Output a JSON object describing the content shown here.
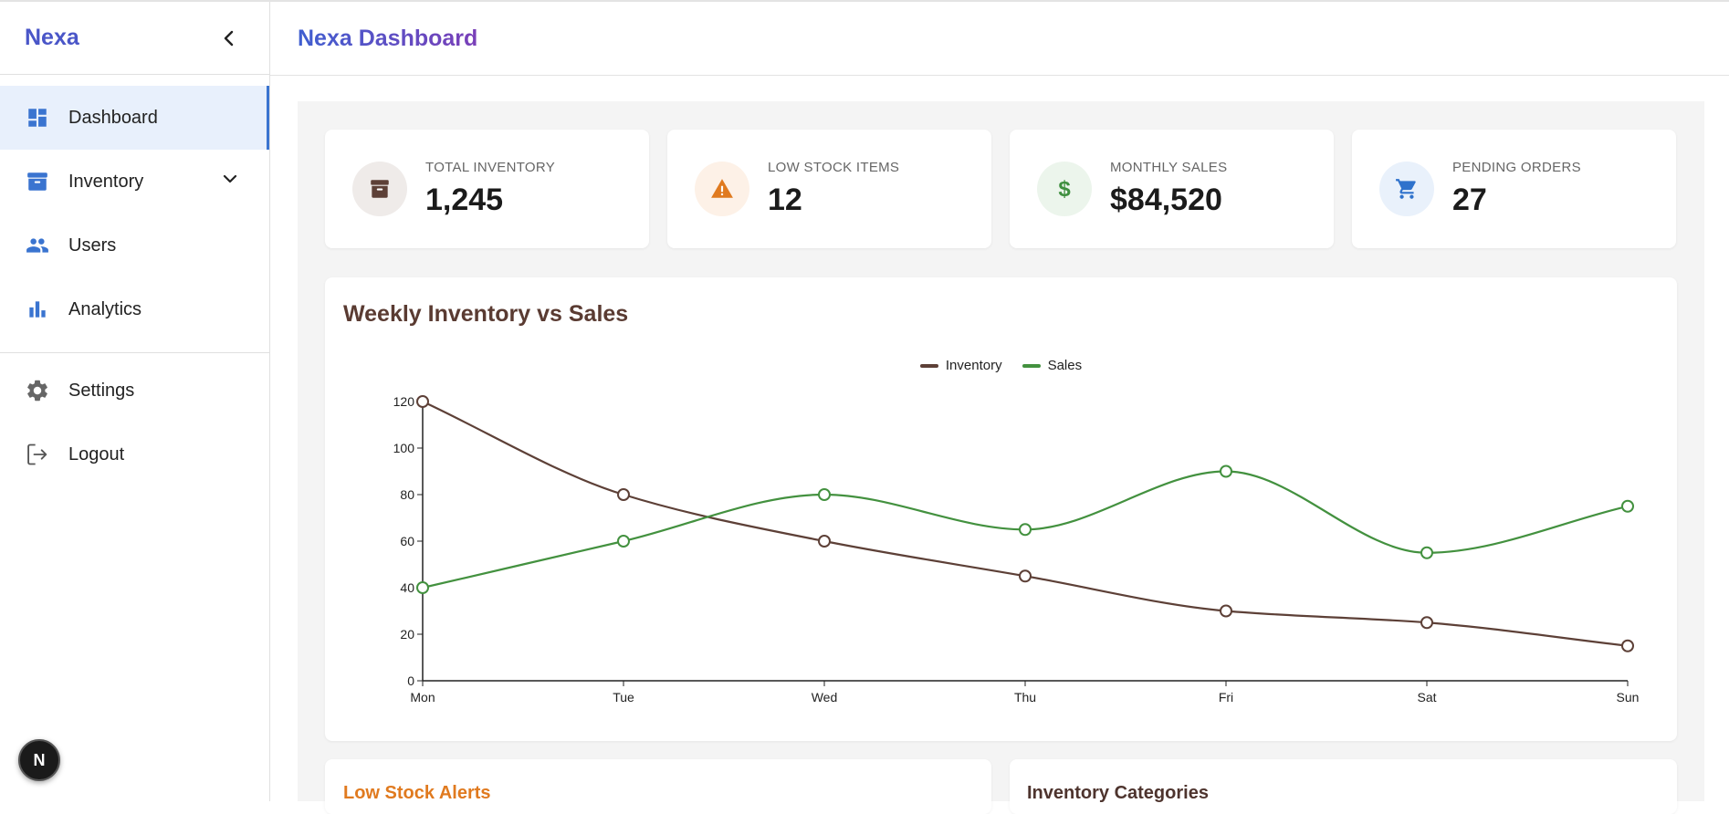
{
  "sidebar": {
    "brand": "Nexa",
    "items": [
      {
        "label": "Dashboard"
      },
      {
        "label": "Inventory"
      },
      {
        "label": "Users"
      },
      {
        "label": "Analytics"
      }
    ],
    "bottom_items": [
      {
        "label": "Settings"
      },
      {
        "label": "Logout"
      }
    ],
    "next_badge": "N"
  },
  "header": {
    "title": "Nexa Dashboard"
  },
  "stats": [
    {
      "label": "TOTAL INVENTORY",
      "value": "1,245",
      "icon": "archive-icon",
      "color": "#5d4037",
      "bg": "#efebe9"
    },
    {
      "label": "LOW STOCK ITEMS",
      "value": "12",
      "icon": "warning-icon",
      "color": "#e07a1f",
      "bg": "#fdf1e7"
    },
    {
      "label": "MONTHLY SALES",
      "value": "$84,520",
      "icon": "dollar-icon",
      "color": "#3f8f3f",
      "bg": "#ecf5ec"
    },
    {
      "label": "PENDING ORDERS",
      "value": "27",
      "icon": "cart-icon",
      "color": "#2f72cc",
      "bg": "#e9f1fb"
    }
  ],
  "chart": {
    "title": "Weekly Inventory vs Sales"
  },
  "chart_data": {
    "type": "line",
    "categories": [
      "Mon",
      "Tue",
      "Wed",
      "Thu",
      "Fri",
      "Sat",
      "Sun"
    ],
    "series": [
      {
        "name": "Inventory",
        "values": [
          120,
          80,
          60,
          45,
          30,
          25,
          15
        ],
        "color": "#5d4037"
      },
      {
        "name": "Sales",
        "values": [
          40,
          60,
          80,
          65,
          90,
          55,
          75
        ],
        "color": "#43913f"
      }
    ],
    "ylim": [
      0,
      120
    ],
    "yticks": [
      0,
      20,
      40,
      60,
      80,
      100,
      120
    ],
    "grid": false,
    "legend": "top-center"
  },
  "bottom": {
    "low_stock_title": "Low Stock Alerts",
    "low_stock_color": "#e07a1f",
    "categories_title": "Inventory Categories",
    "categories_color": "#4e342e"
  }
}
